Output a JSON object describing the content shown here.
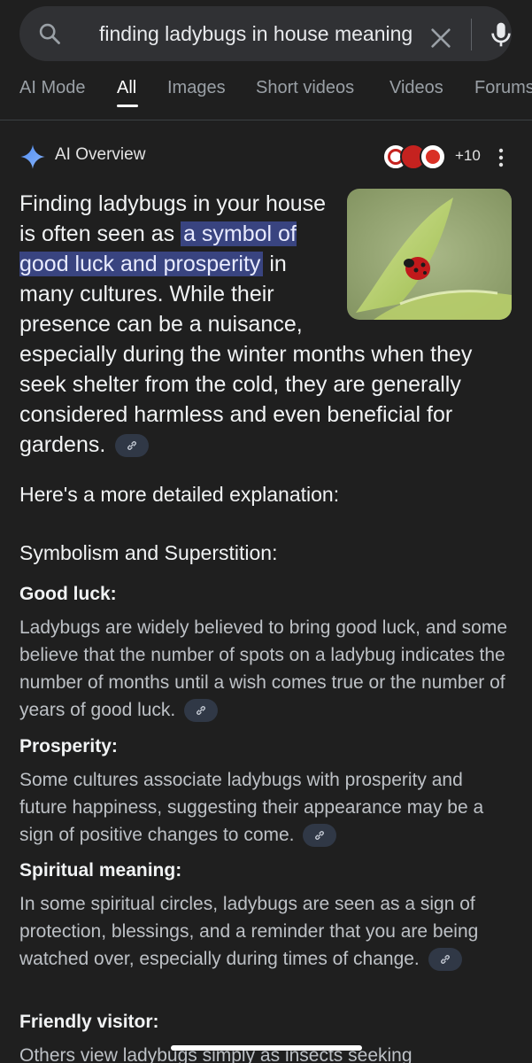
{
  "search": {
    "query": "finding ladybugs in house meaning",
    "search_icon": "search-icon",
    "clear_icon": "close-icon",
    "mic_icon": "microphone-icon"
  },
  "tabs": [
    {
      "label": "AI Mode"
    },
    {
      "label": "All",
      "active": true
    },
    {
      "label": "Images"
    },
    {
      "label": "Short videos"
    },
    {
      "label": "Videos"
    },
    {
      "label": "Forums"
    }
  ],
  "ai_overview": {
    "title": "AI Overview",
    "sources_more": "+10",
    "intro_part1": "Finding ladybugs in your house is often seen as ",
    "intro_highlight": "a symbol of good luck and prosperity",
    "intro_part2": " in many cultures. While their presence can be a nuisance, especially during the winter months when they seek shelter from the cold, they are generally considered harmless and even beneficial for gardens.",
    "explain": "Here's a more detailed explanation:",
    "section_heading": "Symbolism and Superstition:",
    "items": [
      {
        "heading": "Good luck:",
        "body": "Ladybugs are widely believed to bring good luck, and some believe that the number of spots on a ladybug indicates the number of months until a wish comes true or the number of years of good luck."
      },
      {
        "heading": "Prosperity:",
        "body": "Some cultures associate ladybugs with prosperity and future happiness, suggesting their appearance may be a sign of positive changes to come."
      },
      {
        "heading": "Spiritual meaning:",
        "body": "In some spiritual circles, ladybugs are seen as a sign of protection, blessings, and a reminder that you are being watched over, especially during times of change."
      },
      {
        "heading": "Friendly visitor:",
        "body": "Others view ladybugs simply as insects seeking"
      }
    ]
  },
  "colors": {
    "background": "#1f1f1f",
    "highlight": "#394480",
    "search_bar": "#303134"
  }
}
